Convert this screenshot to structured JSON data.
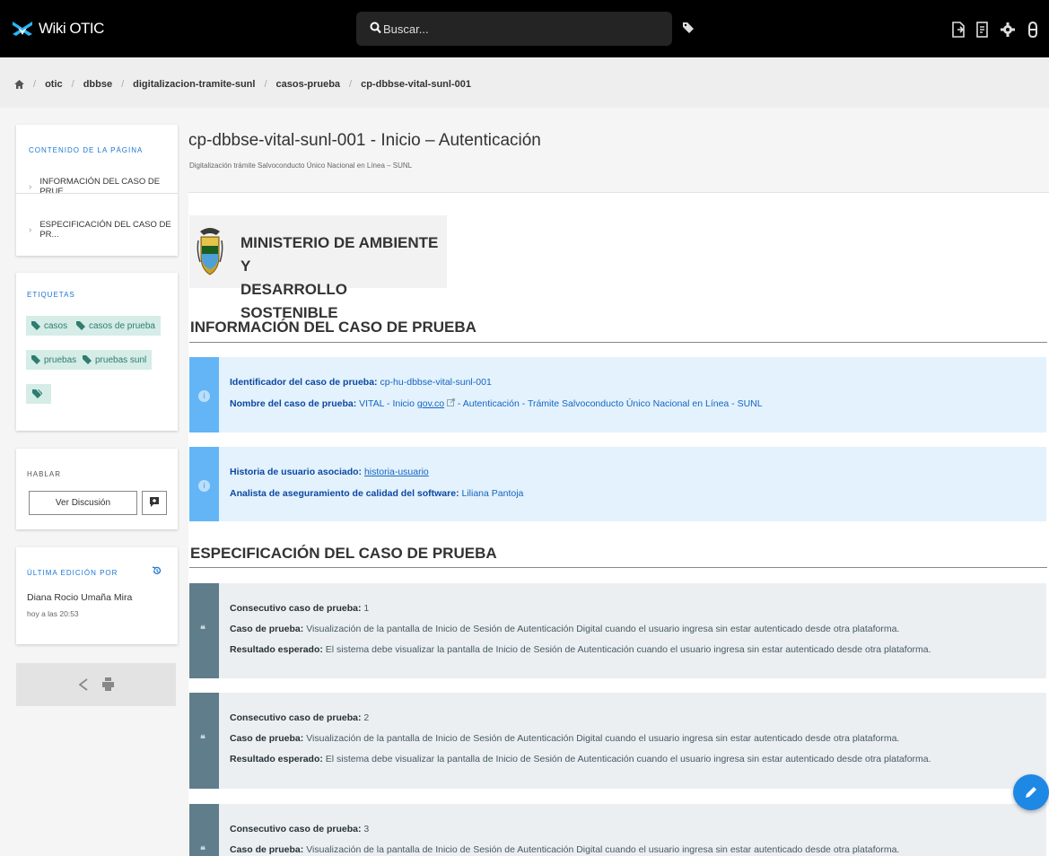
{
  "app": {
    "title": "Wiki OTIC"
  },
  "search": {
    "placeholder": "Buscar..."
  },
  "breadcrumb": [
    "otic",
    "dbbse",
    "digitalizacion-tramite-sunl",
    "casos-prueba",
    "cp-dbbse-vital-sunl-001"
  ],
  "sidebar": {
    "toc": {
      "title": "CONTENIDO DE LA PÁGINA",
      "items": [
        "INFORMACIÓN DEL CASO DE PRUE...",
        "ESPECIFICACIÓN DEL CASO DE PR..."
      ]
    },
    "tags": {
      "title": "ETIQUETAS",
      "items": [
        "casos",
        "casos de prueba",
        "pruebas",
        "pruebas sunl"
      ]
    },
    "talk": {
      "title": "HABLAR",
      "discuss_label": "Ver Discusión"
    },
    "last_edit": {
      "title": "ÚLTIMA EDICIÓN POR",
      "author": "Diana Rocio Umaña Mira",
      "time": "hoy a las 20:53"
    }
  },
  "page": {
    "title": "cp-dbbse-vital-sunl-001 - Inicio – Autenticación",
    "subtitle": "Digitalización trámite Salvoconducto Único Nacional en Línea – SUNL"
  },
  "ministry": {
    "line1": "MINISTERIO DE AMBIENTE Y",
    "line2": "DESARROLLO SOSTENIBLE"
  },
  "info_section": {
    "heading": "INFORMACIÓN DEL CASO DE PRUEBA",
    "box1": {
      "id_label": "Identificador del caso de prueba:",
      "id_value": "cp-hu-dbbse-vital-sunl-001",
      "name_label": "Nombre del caso de prueba:",
      "name_prefix": "VITAL - Inicio",
      "name_link": "gov.co",
      "name_suffix": "- Autenticación - Trámite Salvoconducto Único Nacional en Línea - SUNL"
    },
    "box2": {
      "story_label": "Historia de usuario asociado:",
      "story_link": "historia-usuario",
      "analyst_label": "Analista de aseguramiento de calidad del software:",
      "analyst_value": "Liliana Pantoja"
    }
  },
  "spec_section": {
    "heading": "ESPECIFICACIÓN DEL CASO DE PRUEBA",
    "consec_label": "Consecutivo caso de prueba:",
    "case_label": "Caso de prueba:",
    "result_label": "Resultado esperado:",
    "items": [
      {
        "num": "1",
        "case": "Visualización de la pantalla de Inicio de Sesión de Autenticación Digital cuando el usuario ingresa sin estar autenticado desde otra plataforma.",
        "result": "El sistema debe visualizar la pantalla de Inicio de Sesión de Autenticación cuando el usuario ingresa sin estar autenticado desde otra plataforma."
      },
      {
        "num": "2",
        "case": "Visualización de la pantalla de Inicio de Sesión de Autenticación Digital cuando el usuario ingresa sin estar autenticado desde otra plataforma.",
        "result": "El sistema debe visualizar la pantalla de Inicio de Sesión de Autenticación cuando el usuario ingresa sin estar autenticado desde otra plataforma."
      },
      {
        "num": "3",
        "case": "Visualización de la pantalla de Inicio de Sesión de Autenticación Digital cuando el usuario ingresa sin estar autenticado desde otra plataforma.",
        "result": ""
      }
    ]
  },
  "colors": {
    "topbar": "#000000",
    "accent": "#1976d2",
    "info_bg": "#e3f2fd",
    "info_bar": "#64b5f6",
    "spec_bar": "#607d8b",
    "tag_bg": "#d5ece7"
  }
}
